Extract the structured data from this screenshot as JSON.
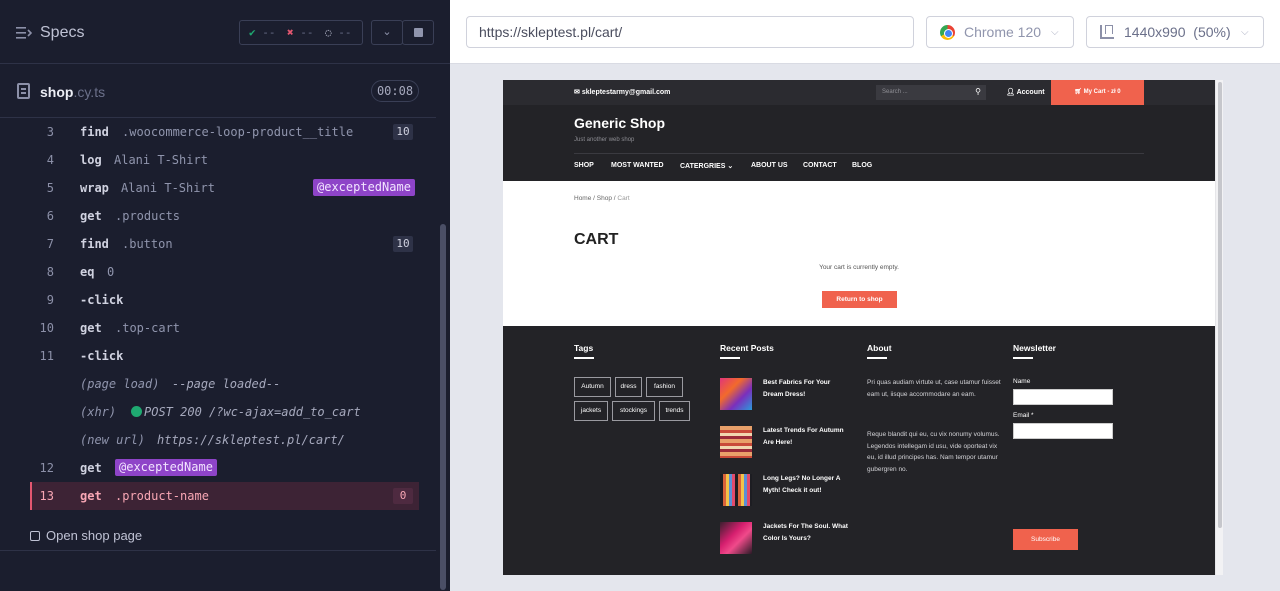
{
  "reporter": {
    "title": "Specs",
    "stats": {
      "passed": "--",
      "failed": "--",
      "pending": "--"
    },
    "file": {
      "name": "shop",
      "ext": ".cy.ts",
      "duration": "00:08"
    },
    "commands": [
      {
        "num": "3",
        "name": "find",
        "message": ".woocommerce-loop-product__title",
        "count": "10"
      },
      {
        "num": "4",
        "name": "log",
        "message": "Alani T-Shirt"
      },
      {
        "num": "5",
        "name": "wrap",
        "message": "Alani T-Shirt",
        "alias": "@exceptedName"
      },
      {
        "num": "6",
        "name": "get",
        "message": ".products"
      },
      {
        "num": "7",
        "name": "find",
        "message": ".button",
        "count": "10"
      },
      {
        "num": "8",
        "name": "eq",
        "message": "0"
      },
      {
        "num": "9",
        "name": "-click",
        "message": ""
      },
      {
        "num": "10",
        "name": "get",
        "message": ".top-cart"
      },
      {
        "num": "11",
        "name": "-click",
        "message": ""
      },
      {
        "num": "",
        "event": "(page load)",
        "message": "--page loaded--"
      },
      {
        "num": "",
        "event": "(xhr)",
        "message": "POST 200 /?wc-ajax=add_to_cart"
      },
      {
        "num": "",
        "event": "(new url)",
        "message": "https://skleptest.pl/cart/"
      },
      {
        "num": "12",
        "name": "get",
        "alias": "@exceptedName"
      },
      {
        "num": "13",
        "name": "get",
        "message": ".product-name",
        "count": "0"
      }
    ],
    "next_test": "Open shop page"
  },
  "aut": {
    "url": "https://skleptest.pl/cart/",
    "browser": "Chrome 120",
    "viewport": "1440x990",
    "scale": "(50%)"
  },
  "site": {
    "topbar": {
      "email": "skleptestarmy@gmail.com",
      "search_placeholder": "Search ...",
      "account": "Account",
      "cart": "My Cart - zł 0"
    },
    "header": {
      "title": "Generic Shop",
      "subtitle": "Just another web shop",
      "nav": [
        "SHOP",
        "MOST WANTED",
        "CATERGRIES",
        "ABOUT US",
        "CONTACT",
        "BLOG"
      ]
    },
    "breadcrumb": {
      "home": "Home",
      "shop": "Shop",
      "current": "Cart"
    },
    "page_title": "CART",
    "empty_message": "Your cart is currently empty.",
    "return_button": "Return to shop",
    "footer": {
      "tags_title": "Tags",
      "tags": [
        "Autumn",
        "dress",
        "fashion",
        "jackets",
        "stockings",
        "trends"
      ],
      "posts_title": "Recent Posts",
      "posts": [
        "Best Fabrics For Your Dream Dress!",
        "Latest Trends For Autumn Are Here!",
        "Long Legs? No Longer A Myth! Check it out!",
        "Jackets For The Soul. What Color Is Yours?"
      ],
      "about_title": "About",
      "about_p1": "Pri quas audiam virtute ut, case utamur fuisset eam ut, iisque accommodare an eam.",
      "about_p2": "Reque blandit qui eu, cu vix nonumy volumus. Legendos intellegam id usu, vide oporteat vix eu, id illud principes has. Nam tempor utamur gubergren no.",
      "newsletter_title": "Newsletter",
      "name_label": "Name",
      "email_label": "Email *",
      "subscribe": "Subscribe"
    }
  },
  "colors": {
    "reporter_bg": "#1b1e2e",
    "passed": "#1fa971",
    "failed": "#e45770",
    "alias": "#8e44c8",
    "accent": "#f0624d"
  }
}
